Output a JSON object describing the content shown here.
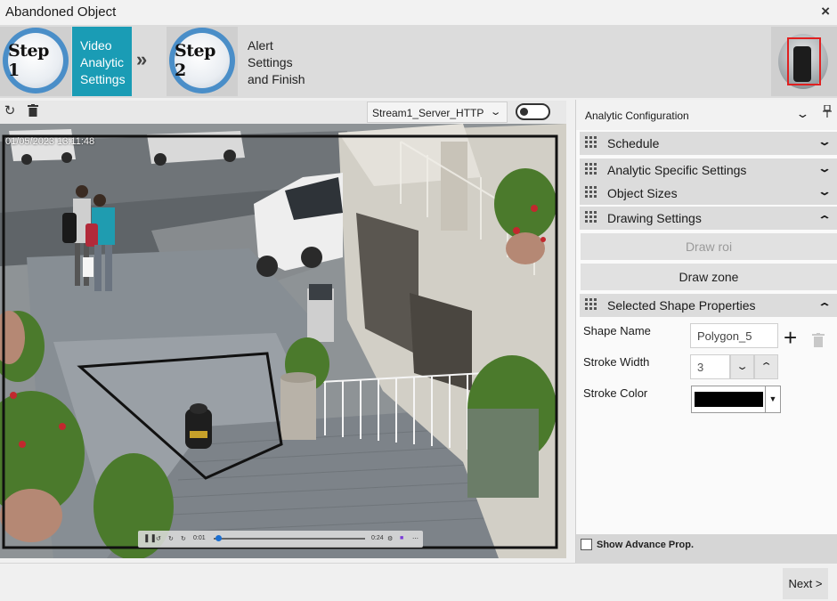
{
  "window": {
    "title": "Abandoned Object",
    "close_icon": "×"
  },
  "steps": [
    {
      "badge": "Step 1",
      "lines": [
        "Video",
        "Analytic",
        "Settings"
      ],
      "active": true
    },
    {
      "badge": "Step 2",
      "lines": [
        "Alert",
        "Settings",
        "and Finish"
      ],
      "active": false
    }
  ],
  "step_separator": "»",
  "accent_color": "#1a9cb5",
  "video_toolbar": {
    "stream": "Stream1_Server_HTTP",
    "stream_caret": "⌄",
    "refresh_icon": "↻",
    "delete_icon": "trash-icon"
  },
  "video": {
    "timestamp": "01/05/2023 13:11:48"
  },
  "player": {
    "time_start": "0:01",
    "time_end": "0:24",
    "progress": 0.03
  },
  "panel": {
    "title": "Analytic Configuration",
    "caret": "⌄",
    "pin": "📌",
    "sections": {
      "schedule": "Schedule",
      "analytic_specific": "Analytic Specific Settings",
      "object_sizes": "Object Sizes",
      "drawing": "Drawing Settings",
      "selected_shape": "Selected Shape Properties"
    },
    "collapsed_chevron": "⌄",
    "expanded_chevron": "⌃",
    "draw_roi": "Draw roi",
    "draw_zone": "Draw zone",
    "shape_name_label": "Shape Name",
    "shape_name_value": "Polygon_5",
    "add_icon": "+",
    "stroke_width_label": "Stroke Width",
    "stroke_width_value": "3",
    "spin_down": "⌄",
    "spin_up": "⌃",
    "stroke_color_label": "Stroke Color",
    "stroke_color": "#000000",
    "color_dropdown": "▼",
    "show_advance": "Show Advance Prop."
  },
  "footer": {
    "next_label": "Next >"
  }
}
